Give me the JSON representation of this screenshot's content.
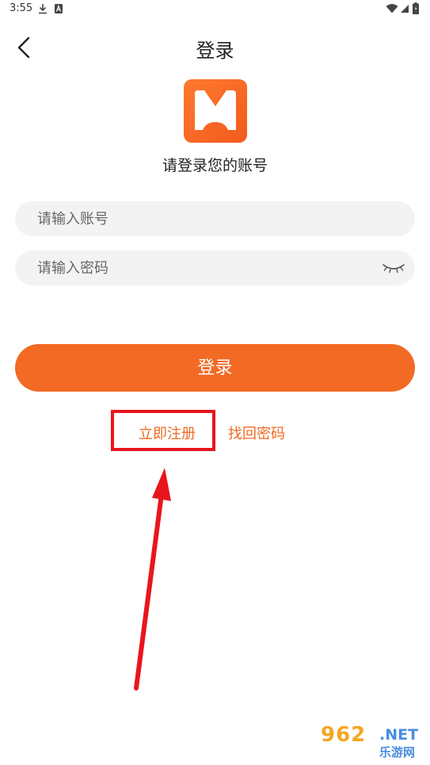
{
  "status_bar": {
    "time": "3:55"
  },
  "header": {
    "title": "登录"
  },
  "logo": {
    "letter": "M"
  },
  "subtitle": "请登录您的账号",
  "form": {
    "account_placeholder": "请输入账号",
    "password_placeholder": "请输入密码"
  },
  "login_button": {
    "label": "登录"
  },
  "links": {
    "register": "立即注册",
    "forgot_password": "找回密码"
  },
  "watermark": {
    "number": "962",
    "domain": ".NET",
    "name": "乐游网"
  },
  "colors": {
    "accent": "#f26a24",
    "link": "#ef6a24",
    "annotation": "#e8161c",
    "input_bg": "#f3f3f3"
  },
  "icons": {
    "back": "chevron-left-icon",
    "eye": "eye-closed-icon",
    "download": "download-icon",
    "wifi": "wifi-icon",
    "signal": "signal-icon",
    "battery": "battery-icon"
  }
}
